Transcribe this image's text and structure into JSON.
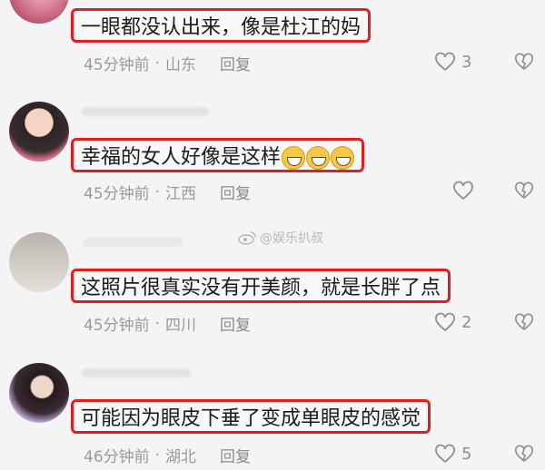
{
  "comments": [
    {
      "text": "一眼都没认出来，像是杜江的妈",
      "time": "45分钟前",
      "location": "山东",
      "reply_label": "回复",
      "likes": "3",
      "emoji_count": 0
    },
    {
      "text": "幸福的女人好像是这样",
      "time": "45分钟前",
      "location": "江西",
      "reply_label": "回复",
      "likes": "",
      "emoji_count": 3
    },
    {
      "text": "这照片很真实没有开美颜，就是长胖了点",
      "time": "45分钟前",
      "location": "四川",
      "reply_label": "回复",
      "likes": "2",
      "emoji_count": 0
    },
    {
      "text": "可能因为眼皮下垂了变成单眼皮的感觉",
      "time": "46分钟前",
      "location": "湖北",
      "reply_label": "回复",
      "likes": "5",
      "emoji_count": 0
    }
  ],
  "separator": "·",
  "watermark": "@娱乐扒叔",
  "icons": {
    "like": "heart-outline-icon",
    "dislike": "broken-heart-icon",
    "emoji": "grinning-face-icon",
    "watermark": "weibo-icon"
  },
  "colors": {
    "highlight_border": "#e02020",
    "meta_text": "#9a9a9e",
    "background": "#f4f4f6"
  }
}
